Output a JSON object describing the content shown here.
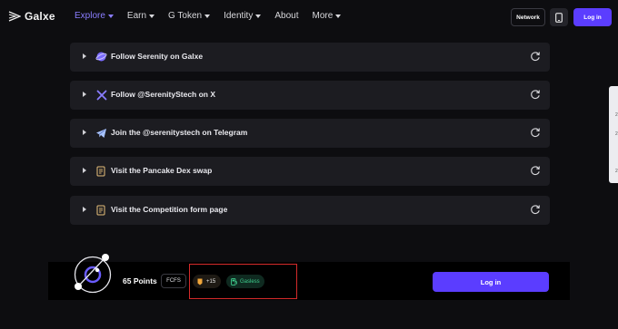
{
  "header": {
    "logo_text": "Galxe",
    "nav": [
      {
        "label": "Explore",
        "dropdown": true,
        "active": true
      },
      {
        "label": "Earn",
        "dropdown": true
      },
      {
        "label": "G Token",
        "dropdown": true
      },
      {
        "label": "Identity",
        "dropdown": true
      },
      {
        "label": "About",
        "dropdown": false
      },
      {
        "label": "More",
        "dropdown": true
      }
    ],
    "network_label": "Network",
    "login_label": "Log in"
  },
  "tasks": [
    {
      "label": "Follow Serenity on Galxe",
      "icon": "galxe-follow-icon"
    },
    {
      "label": "Follow @SerenityStech on X",
      "icon": "x-icon"
    },
    {
      "label": "Join the @serenitystech on Telegram",
      "icon": "telegram-icon"
    },
    {
      "label": "Visit the Pancake Dex swap",
      "icon": "visit-link-icon"
    },
    {
      "label": "Visit the Competition form page",
      "icon": "visit-link-icon"
    }
  ],
  "side_marks": [
    "2",
    "2",
    "2"
  ],
  "footer": {
    "points": "65 Points",
    "fcfs": "FCFS",
    "plus_badge": "+15",
    "gasless_badge": "Gasless",
    "login_label": "Log in"
  },
  "colors": {
    "background": "#0d0d10",
    "accent": "#5b3dff",
    "nav_active": "#8a7dff",
    "card": "#1c1c21",
    "highlight_border": "#d42a2a",
    "gasless_green": "#3fcf8e"
  }
}
